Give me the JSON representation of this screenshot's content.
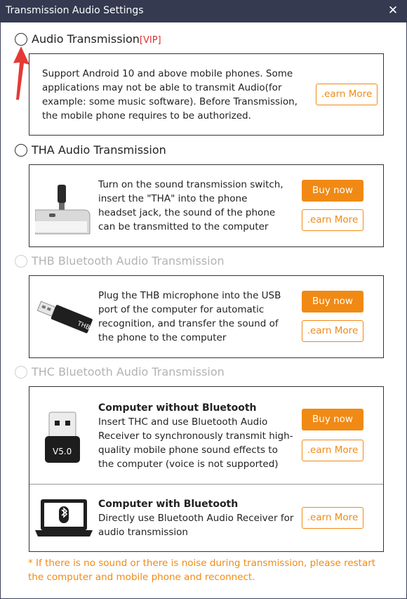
{
  "window": {
    "title": "Transmission Audio Settings",
    "close_glyph": "✕"
  },
  "options": [
    {
      "label": "Audio Transmission",
      "badge": "[VIP]",
      "description": "Support Android 10 and above mobile phones. Some applications may not be able to transmit Audio(for example: some music software). Before Transmission, the mobile phone requires to be authorized.",
      "learn_more": ".earn More",
      "selected": false
    },
    {
      "label": "THA Audio Transmission",
      "description": "Turn on the sound transmission switch, insert the \"THA\" into the phone headset jack, the sound of the phone can be transmitted to the computer",
      "buy_now": "Buy now",
      "learn_more": ".earn More",
      "image": "tha-headset-adapter-image",
      "selected": false
    },
    {
      "label": "THB Bluetooth Audio Transmission",
      "description": "Plug the THB microphone into the USB port of the computer for automatic recognition, and transfer the sound of the phone to the computer",
      "buy_now": "Buy now",
      "learn_more": ".earn More",
      "image": "thb-usb-dongle-image",
      "image_text": "THB",
      "disabled": true
    },
    {
      "label": "THC Bluetooth Audio Transmission",
      "disabled": true,
      "sections": [
        {
          "heading": "Computer without Bluetooth",
          "description": "Insert THC and use Bluetooth Audio Receiver to synchronously transmit high-quality mobile phone sound effects to the computer (voice is not supported)",
          "buy_now": "Buy now",
          "learn_more": ".earn More",
          "image": "thc-usb-receiver-image",
          "image_text": "V5.0"
        },
        {
          "heading": "Computer with Bluetooth",
          "description": "Directly use Bluetooth Audio Receiver for audio transmission",
          "learn_more": ".earn More",
          "image": "laptop-bluetooth-image"
        }
      ]
    }
  ],
  "footer_note": "* If there is no sound or there is noise during transmission, please restart the computer and mobile phone and reconnect.",
  "colors": {
    "titlebar": "#353a51",
    "accent": "#f08a14",
    "vip": "#e03131",
    "disabled": "#b3b3b3",
    "annotation_arrow": "#e53935"
  },
  "icons": [
    "close-icon",
    "radio-icon",
    "annotation-arrow-icon"
  ]
}
